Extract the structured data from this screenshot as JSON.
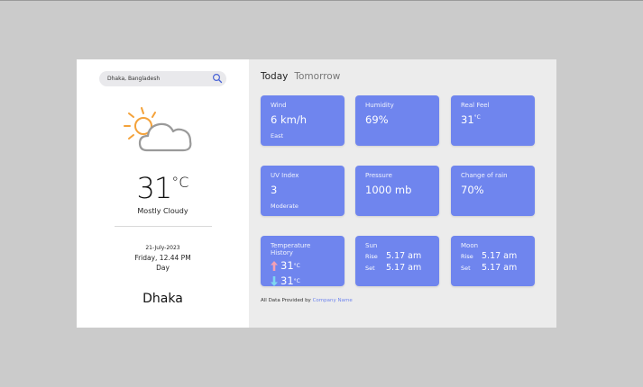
{
  "search": {
    "value": "Dhaka, Bangladesh"
  },
  "current": {
    "temp": "31",
    "unit": "°C",
    "condition": "Mostly Cloudy",
    "date": "21-July-2023",
    "time": "Friday, 12.44 PM",
    "period": "Day",
    "city": "Dhaka"
  },
  "tabs": [
    "Today",
    "Tomorrow"
  ],
  "cards": {
    "wind": {
      "label": "Wind",
      "value": "6 km/h",
      "sub": "East"
    },
    "humidity": {
      "label": "Humidity",
      "value": "69%"
    },
    "realfeel": {
      "label": "Real Feel",
      "value": "31",
      "unit": "°C"
    },
    "uv": {
      "label": "UV Index",
      "value": "3",
      "sub": "Moderate"
    },
    "pressure": {
      "label": "Pressure",
      "value": "1000 mb"
    },
    "rain": {
      "label": "Change of rain",
      "value": "70%"
    },
    "history": {
      "label": "Temperature History",
      "high": "31",
      "low": "31",
      "unit": "°C"
    },
    "sun": {
      "label": "Sun",
      "rise_label": "Rise",
      "rise": "5.17 am",
      "set_label": "Set",
      "set": "5.17 am"
    },
    "moon": {
      "label": "Moon",
      "rise_label": "Rise",
      "rise": "5.17 am",
      "set_label": "Set",
      "set": "5.17 am"
    }
  },
  "footer": {
    "text": "All Data Provided by",
    "brand": "Company Name"
  },
  "colors": {
    "card": "#6f85ee",
    "sun": "#f4a23a",
    "arrow_up": "#f4a0b4",
    "arrow_down": "#7fd8f0"
  }
}
